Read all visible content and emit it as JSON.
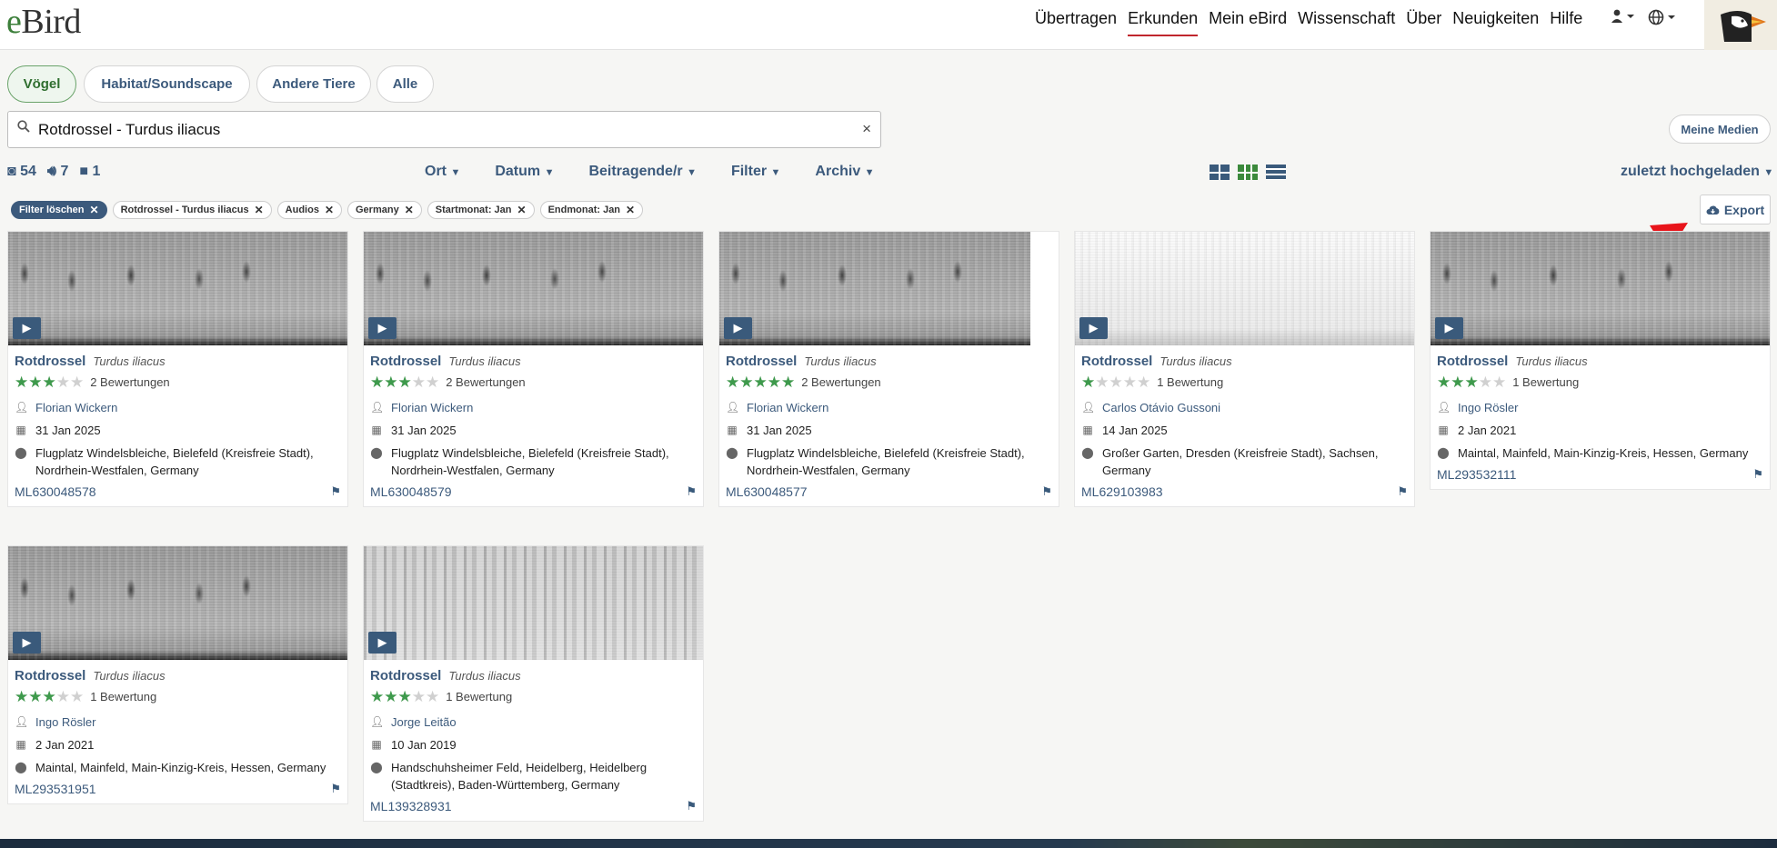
{
  "logo": {
    "e": "e",
    "bird": "Bird"
  },
  "nav": [
    "Übertragen",
    "Erkunden",
    "Mein eBird",
    "Wissenschaft",
    "Über",
    "Neuigkeiten",
    "Hilfe"
  ],
  "header_icons": {
    "user": "user-icon",
    "globe": "globe-icon"
  },
  "media_tabs": [
    "Vögel",
    "Habitat/Soundscape",
    "Andere Tiere",
    "Alle"
  ],
  "search": {
    "value": "Rotdrossel - Turdus iliacus",
    "clear": "×"
  },
  "meine_medien": "Meine Medien",
  "counts": {
    "photos": "54",
    "audio": "7",
    "video": "1"
  },
  "dropdowns": [
    "Ort",
    "Datum",
    "Beitragende/r",
    "Filter",
    "Archiv"
  ],
  "sort_label": "zuletzt hochgeladen",
  "chips": [
    "Filter löschen",
    "Rotdrossel - Turdus iliacus",
    "Audios",
    "Germany",
    "Startmonat: Jan",
    "Endmonat: Jan"
  ],
  "export_label": "Export",
  "accent_colors": {
    "link": "#3c5a7c",
    "green": "#3e9a4c",
    "nav_underline": "#c0262d",
    "arrow": "#e8141a"
  },
  "cards": [
    {
      "name": "Rotdrossel",
      "sci": "Turdus iliacus",
      "stars": 3,
      "ratings": "2 Bewertungen",
      "user": "Florian Wickern",
      "date": "31 Jan 2025",
      "location": "Flugplatz Windelsbleiche, Bielefeld (Kreisfreie Stadt), Nordrhein-Westfalen, Germany",
      "ml": "ML630048578"
    },
    {
      "name": "Rotdrossel",
      "sci": "Turdus iliacus",
      "stars": 3,
      "ratings": "2 Bewertungen",
      "user": "Florian Wickern",
      "date": "31 Jan 2025",
      "location": "Flugplatz Windelsbleiche, Bielefeld (Kreisfreie Stadt), Nordrhein-Westfalen, Germany",
      "ml": "ML630048579"
    },
    {
      "name": "Rotdrossel",
      "sci": "Turdus iliacus",
      "stars": 5,
      "ratings": "2 Bewertungen",
      "user": "Florian Wickern",
      "date": "31 Jan 2025",
      "location": "Flugplatz Windelsbleiche, Bielefeld (Kreisfreie Stadt), Nordrhein-Westfalen, Germany",
      "ml": "ML630048577"
    },
    {
      "name": "Rotdrossel",
      "sci": "Turdus iliacus",
      "stars": 1,
      "ratings": "1 Bewertung",
      "user": "Carlos Otávio Gussoni",
      "date": "14 Jan 2025",
      "location": "Großer Garten, Dresden (Kreisfreie Stadt), Sachsen, Germany",
      "ml": "ML629103983"
    },
    {
      "name": "Rotdrossel",
      "sci": "Turdus iliacus",
      "stars": 3,
      "ratings": "1 Bewertung",
      "user": "Ingo Rösler",
      "date": "2 Jan 2021",
      "location": "Maintal, Mainfeld, Main-Kinzig-Kreis, Hessen, Germany",
      "ml": "ML293532111"
    },
    {
      "name": "Rotdrossel",
      "sci": "Turdus iliacus",
      "stars": 3,
      "ratings": "1 Bewertung",
      "user": "Ingo Rösler",
      "date": "2 Jan 2021",
      "location": "Maintal, Mainfeld, Main-Kinzig-Kreis, Hessen, Germany",
      "ml": "ML293531951"
    },
    {
      "name": "Rotdrossel",
      "sci": "Turdus iliacus",
      "stars": 3,
      "ratings": "1 Bewertung",
      "user": "Jorge Leitão",
      "date": "10 Jan 2019",
      "location": "Handschuhsheimer Feld, Heidelberg, Heidelberg (Stadtkreis), Baden-Württemberg, Germany",
      "ml": "ML139328931"
    }
  ]
}
